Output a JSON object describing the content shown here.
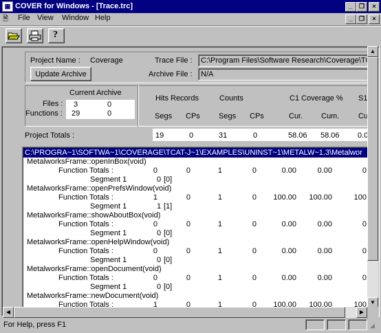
{
  "window": {
    "title": "COVER for Windows - [Trace.trc]"
  },
  "menu": {
    "items": [
      "File",
      "View",
      "Window",
      "Help"
    ]
  },
  "toolbar": {
    "icons": [
      "open-folder-icon",
      "print-icon",
      "help-question-icon"
    ]
  },
  "project": {
    "name_label": "Project Name :",
    "name_value": "Coverage",
    "update_button": "Update Archive",
    "trace_label": "Trace File :",
    "trace_value": "C:\\Program Files\\Software Research\\Coverage\\TC",
    "archive_label": "Archive File :",
    "archive_value": "N/A"
  },
  "stats": {
    "current_header": "Current",
    "archive_header": "Archive",
    "files_label": "Files :",
    "files_current": "3",
    "files_archive": "0",
    "functions_label": "Functions :",
    "functions_current": "29",
    "functions_archive": "0"
  },
  "columns": {
    "hits_records": "Hits Records",
    "counts": "Counts",
    "c1": "C1 Coverage %",
    "s1": "S1",
    "segs": "Segs",
    "cps": "CPs",
    "segs2": "Segs",
    "cps2": "CPs",
    "cur": "Cur.",
    "cum": "Cum.",
    "cu": "Cu"
  },
  "totals": {
    "label": "Project Totals :",
    "values": [
      "19",
      "0",
      "31",
      "0",
      "58.06",
      "58.06",
      "0.0"
    ]
  },
  "detail": {
    "path": "C:\\PROGRA~1\\SOFTWA~1\\COVERAGE\\TCAT-J~1\\EXAMPLES\\UNINST~1\\METALW~1.3\\Metalwor",
    "rows": [
      {
        "kind": "func",
        "label": "MetalworksFrame::openInBox(void)"
      },
      {
        "kind": "totals",
        "label": "Function Totals :",
        "values": [
          "0",
          "0",
          "1",
          "0",
          "0.00",
          "0.00",
          "0"
        ]
      },
      {
        "kind": "seg",
        "label": "Segment 1",
        "values": [
          "0",
          "[0]"
        ]
      },
      {
        "kind": "func",
        "label": "MetalworksFrame::openPrefsWindow(void)"
      },
      {
        "kind": "totals",
        "label": "Function Totals :",
        "values": [
          "1",
          "0",
          "1",
          "0",
          "100.00",
          "100.00",
          "100"
        ]
      },
      {
        "kind": "seg",
        "label": "Segment 1",
        "values": [
          "1",
          "[1]"
        ]
      },
      {
        "kind": "func",
        "label": "MetalworksFrame::showAboutBox(void)"
      },
      {
        "kind": "totals",
        "label": "Function Totals :",
        "values": [
          "0",
          "0",
          "1",
          "0",
          "0.00",
          "0.00",
          "0"
        ]
      },
      {
        "kind": "seg",
        "label": "Segment 1",
        "values": [
          "0",
          "[0]"
        ]
      },
      {
        "kind": "func",
        "label": "MetalworksFrame::openHelpWindow(void)"
      },
      {
        "kind": "totals",
        "label": "Function Totals :",
        "values": [
          "0",
          "0",
          "1",
          "0",
          "0.00",
          "0.00",
          "0"
        ]
      },
      {
        "kind": "seg",
        "label": "Segment 1",
        "values": [
          "0",
          "[0]"
        ]
      },
      {
        "kind": "func",
        "label": "MetalworksFrame::openDocument(void)"
      },
      {
        "kind": "totals",
        "label": "Function Totals :",
        "values": [
          "0",
          "0",
          "1",
          "0",
          "0.00",
          "0.00",
          "0"
        ]
      },
      {
        "kind": "seg",
        "label": "Segment 1",
        "values": [
          "0",
          "[0]"
        ]
      },
      {
        "kind": "func",
        "label": "MetalworksFrame::newDocument(void)"
      },
      {
        "kind": "totals",
        "label": "Function Totals :",
        "values": [
          "1",
          "0",
          "1",
          "0",
          "100.00",
          "100.00",
          "100"
        ]
      }
    ]
  },
  "status": {
    "text": "For Help, press F1"
  }
}
